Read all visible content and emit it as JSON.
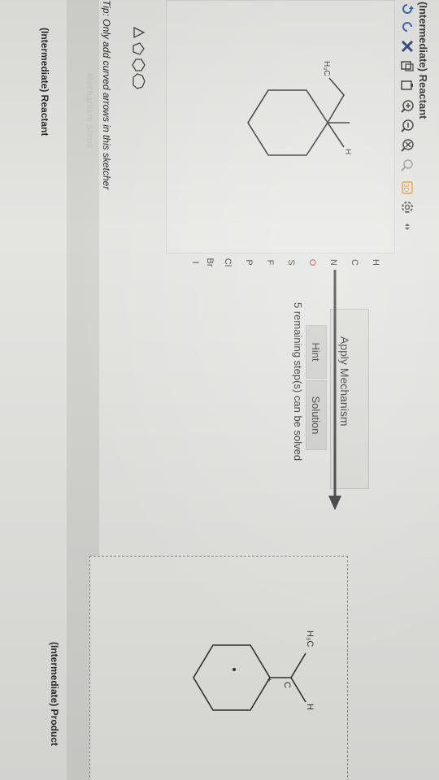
{
  "reactant_panel": {
    "title": "(Intermediate) Reactant",
    "bottom_label": "(Intermediate) Reactant",
    "molecule_labels": {
      "methyl": "H₃C",
      "hydrogen": "H"
    },
    "element_buttons": [
      "H",
      "C",
      "N",
      "O",
      "S",
      "F",
      "P",
      "Cl",
      "Br",
      "I"
    ],
    "toolbar_icons": [
      "undo-icon",
      "redo-icon",
      "clear-icon",
      "copy-icon",
      "paste-icon",
      "zoom-in-icon",
      "zoom-out-icon",
      "zoom-reset-icon",
      "search-icon",
      "3d-icon",
      "settings-icon",
      "expand-icon"
    ]
  },
  "tip": {
    "text": "Tip: Only add curved arrows in this sketcher"
  },
  "steps_bar": {
    "label": "Mechanism Steps"
  },
  "mechanism": {
    "apply_label": "Apply Mechanism",
    "hint_label": "Hint",
    "solution_label": "Solution",
    "remaining_text": "5 remaining step(s) can be solved"
  },
  "product_panel": {
    "label": "(Intermediate) Product",
    "molecule_labels": {
      "methyl": "H₃C",
      "carbon": "C",
      "charge": "+",
      "hydrogen": "H"
    }
  },
  "colors": {
    "screen_bg": "#e4e4e1",
    "text": "#2c2c2c",
    "arrow": "#3a3a3a"
  }
}
